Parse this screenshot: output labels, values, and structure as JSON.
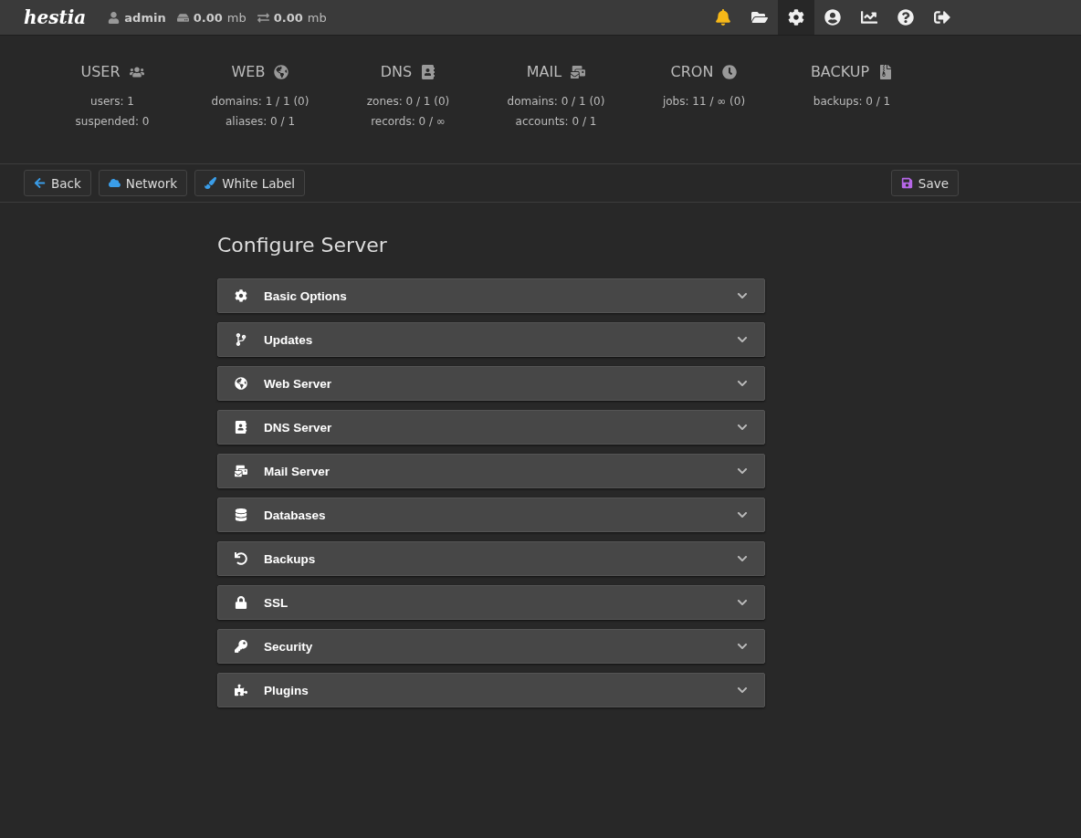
{
  "topbar": {
    "logo": "hestia",
    "user": "admin",
    "disk": "0.00",
    "disk_unit": "mb",
    "bandwidth": "0.00",
    "bandwidth_unit": "mb",
    "nav": [
      {
        "kind": "notifications",
        "selected": false
      },
      {
        "kind": "files",
        "selected": false
      },
      {
        "kind": "settings",
        "selected": true
      },
      {
        "kind": "account",
        "selected": false
      },
      {
        "kind": "stats",
        "selected": false
      },
      {
        "kind": "help",
        "selected": false
      },
      {
        "kind": "logout",
        "selected": false
      }
    ]
  },
  "stats": [
    {
      "kind": "user",
      "title": "USER",
      "lines": [
        "users: 1",
        "suspended: 0"
      ]
    },
    {
      "kind": "web",
      "title": "WEB",
      "lines": [
        "domains: 1 / 1 (0)",
        "aliases: 0 / 1"
      ]
    },
    {
      "kind": "dns",
      "title": "DNS",
      "lines": [
        "zones: 0 / 1 (0)",
        "records: 0 / ∞"
      ]
    },
    {
      "kind": "mail",
      "title": "MAIL",
      "lines": [
        "domains: 0 / 1 (0)",
        "accounts: 0 / 1"
      ]
    },
    {
      "kind": "cron",
      "title": "CRON",
      "lines": [
        "jobs: 11 / ∞ (0)"
      ]
    },
    {
      "kind": "backup",
      "title": "BACKUP",
      "lines": [
        "backups: 0 / 1"
      ]
    }
  ],
  "toolbar": {
    "left": [
      {
        "kind": "back",
        "label": "Back"
      },
      {
        "kind": "network",
        "label": "Network"
      },
      {
        "kind": "label",
        "label": "White Label"
      }
    ],
    "right": [
      {
        "kind": "save",
        "label": "Save"
      }
    ]
  },
  "page_title": "Configure Server",
  "sections": [
    {
      "kind": "basic",
      "title": "Basic Options",
      "expanded": false
    },
    {
      "kind": "updates",
      "title": "Updates",
      "expanded": false
    },
    {
      "kind": "web",
      "title": "Web Server",
      "expanded": false
    },
    {
      "kind": "dns",
      "title": "DNS Server",
      "expanded": false
    },
    {
      "kind": "mail",
      "title": "Mail Server",
      "expanded": false
    },
    {
      "kind": "db",
      "title": "Databases",
      "expanded": false
    },
    {
      "kind": "backups",
      "title": "Backups",
      "expanded": false
    },
    {
      "kind": "ssl",
      "title": "SSL",
      "expanded": false
    },
    {
      "kind": "security",
      "title": "Security",
      "expanded": false
    },
    {
      "kind": "plugins",
      "title": "Plugins",
      "expanded": false
    }
  ]
}
